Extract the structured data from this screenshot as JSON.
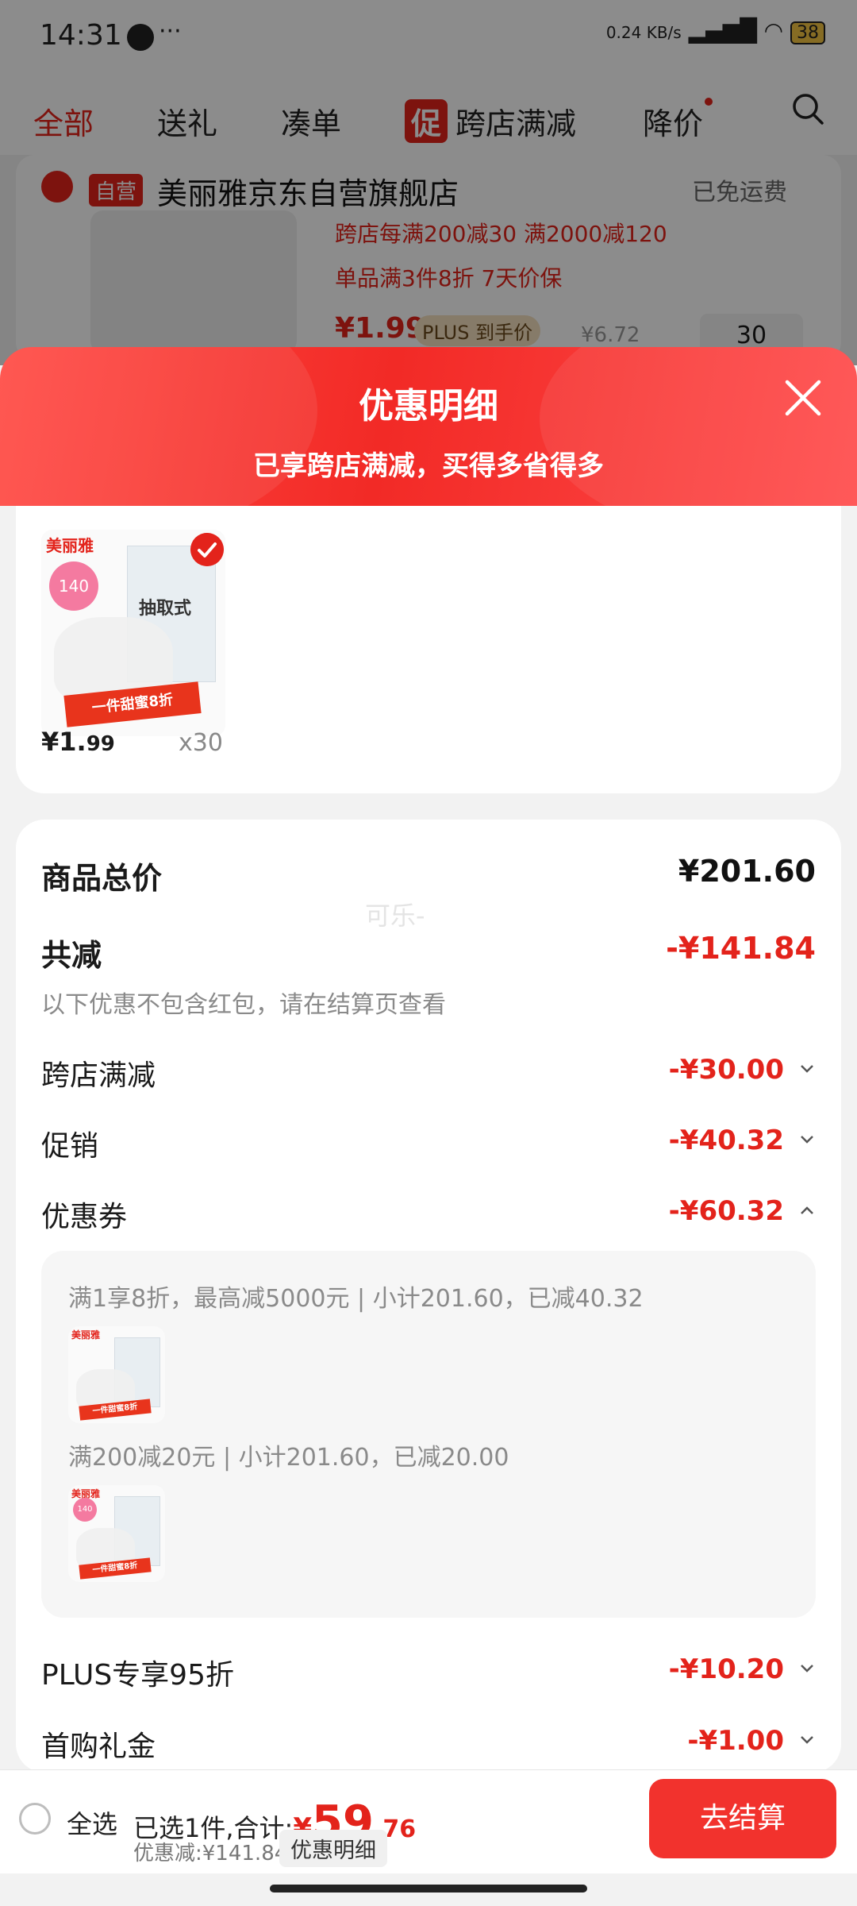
{
  "status_bar": {
    "time": "14:31",
    "network_speed": "0.24 KB/s",
    "battery": "38"
  },
  "top_tabs": {
    "items": [
      {
        "label": "全部",
        "active": true
      },
      {
        "label": "送礼",
        "active": false
      },
      {
        "label": "凑单",
        "active": false
      },
      {
        "label": "跨店满减",
        "badge": "促",
        "active": false
      },
      {
        "label": "降价",
        "active": false
      }
    ]
  },
  "store": {
    "badge": "自营",
    "name": "美丽雅京东自营旗舰店",
    "shipping": "已免运费",
    "promo_line1": "跨店每满200减30  满2000减120",
    "promo_line2": "单品满3件8折  7天价保",
    "price": "¥1.99",
    "plus_label": "PLUS 到手价",
    "orig_price": "¥6.72",
    "quantity": "30"
  },
  "sheet": {
    "title": "优惠明细",
    "subtitle": "已享跨店满减，买得多省得多",
    "product": {
      "brand": "美丽雅",
      "badge_size": "140",
      "package_text": "抽取式",
      "ribbon_text": "一件甜蜜8折",
      "price_main": "¥1.",
      "price_dec": "99",
      "qty": "x30"
    },
    "summary": {
      "total_label": "商品总价",
      "total_value": "¥201.60",
      "watermark": "可乐-",
      "reduction_label": "共减",
      "reduction_value": "-¥141.84",
      "note": "以下优惠不包含红包，请在结算页查看",
      "rows": [
        {
          "label": "跨店满减",
          "value": "-¥30.00"
        },
        {
          "label": "促销",
          "value": "-¥40.32"
        },
        {
          "label": "优惠券",
          "value": "-¥60.32"
        },
        {
          "label": "PLUS专享95折",
          "value": "-¥10.20"
        },
        {
          "label": "首购礼金",
          "value": "-¥1.00"
        }
      ],
      "coupons": [
        "满1享8折，最高减5000元 | 小计201.60，已减40.32",
        "满200减20元 | 小计201.60，已减20.00"
      ]
    }
  },
  "bottom_bar": {
    "select_all": "全选",
    "selected_summary": "已选1件,合计:",
    "total_currency": "¥",
    "total_int": "59",
    "total_dec": ".76",
    "discount_line": "优惠减:¥141.84",
    "detail_chip": "优惠明细",
    "checkout": "去结算"
  },
  "colors": {
    "accent": "#e3231b",
    "header_gradient_start": "#ff4a44",
    "header_gradient_end": "#f22a26"
  }
}
